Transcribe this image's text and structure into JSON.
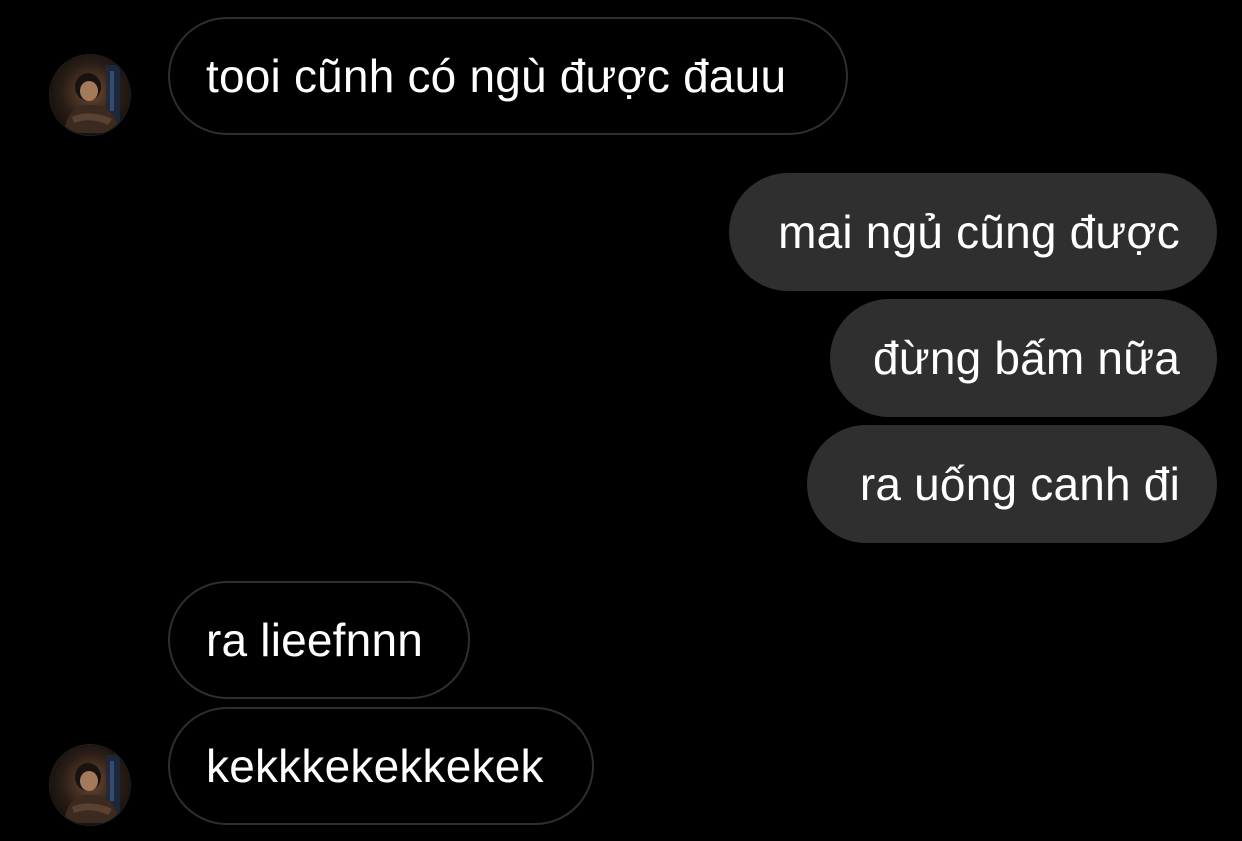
{
  "colors": {
    "background": "#000000",
    "incoming_border": "#2e2e2e",
    "outgoing_fill": "#2f2f2f",
    "text": "#ffffff"
  },
  "messages": [
    {
      "direction": "incoming",
      "text": "tooi cũnh có ngù được đauu",
      "avatar": "contact-avatar"
    },
    {
      "direction": "outgoing",
      "text": "mai ngủ cũng được"
    },
    {
      "direction": "outgoing",
      "text": "đừng bấm nữa"
    },
    {
      "direction": "outgoing",
      "text": "ra uống canh đi"
    },
    {
      "direction": "incoming",
      "text": "ra lieefnnn"
    },
    {
      "direction": "incoming",
      "text": "kekkkekekkekek",
      "avatar": "contact-avatar"
    }
  ]
}
